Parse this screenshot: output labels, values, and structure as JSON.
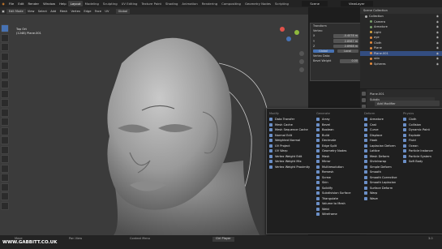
{
  "app": {
    "menu": [
      "File",
      "Edit",
      "Render",
      "Window",
      "Help"
    ],
    "workspaces": [
      "Layout",
      "Modeling",
      "Sculpting",
      "UV Editing",
      "Texture Paint",
      "Shading",
      "Animation",
      "Rendering",
      "Compositing",
      "Geometry Nodes",
      "Scripting"
    ],
    "active_workspace": "Layout",
    "scene_label": "Scene",
    "view_layer_label": "ViewLayer",
    "edit_mode": "Edit Mode"
  },
  "viewport_header": {
    "items": [
      "View",
      "Select",
      "Add",
      "Mesh",
      "Vertex",
      "Edge",
      "Face",
      "UV"
    ],
    "orientation": "Global"
  },
  "overlay_stats": {
    "line1": "Top Ort",
    "line2": "(1248) Plane.001"
  },
  "transform_panel": {
    "title": "Transform",
    "section": "Vertex:",
    "x_label": "X",
    "x_value": "-0.4078 m",
    "y_label": "Y",
    "y_value": "2.8567 m",
    "z_label": "Z",
    "z_value": "2.8968 m",
    "space_global": "Global",
    "space_local": "Local",
    "vertex_data": "Vertex Data:",
    "bevel_label": "Bevel Weight",
    "bevel_value": "0.00"
  },
  "outliner": {
    "header": "Scene Collection",
    "items": [
      {
        "label": "Collection",
        "color": "#b0b0b0",
        "selected": false
      },
      {
        "label": "Camera",
        "color": "#7aa06b",
        "selected": false
      },
      {
        "label": "Armature",
        "color": "#7aa06b",
        "selected": false
      },
      {
        "label": "Light",
        "color": "#d6a543",
        "selected": false
      },
      {
        "label": "eye",
        "color": "#e38a3d",
        "selected": false
      },
      {
        "label": "Cloth",
        "color": "#e38a3d",
        "selected": false
      },
      {
        "label": "Plane",
        "color": "#e38a3d",
        "selected": false
      },
      {
        "label": "Plane.001",
        "color": "#e38a3d",
        "selected": true
      },
      {
        "label": "skin",
        "color": "#e38a3d",
        "selected": false
      },
      {
        "label": "Spheres",
        "color": "#e38a3d",
        "selected": false
      }
    ]
  },
  "properties": {
    "object": "Plane.001",
    "modifier": "Subdiv",
    "add_modifier": "Add Modifier"
  },
  "modifier_menu": {
    "columns": [
      {
        "head": "Modify",
        "items": [
          "Data Transfer",
          "Mesh Cache",
          "Mesh Sequence Cache",
          "Normal Edit",
          "Weighted Normal",
          "UV Project",
          "UV Warp",
          "Vertex Weight Edit",
          "Vertex Weight Mix",
          "Vertex Weight Proximity"
        ]
      },
      {
        "head": "Generate",
        "items": [
          "Array",
          "Bevel",
          "Boolean",
          "Build",
          "Decimate",
          "Edge Split",
          "Geometry Nodes",
          "Mask",
          "Mirror",
          "Multiresolution",
          "Remesh",
          "Screw",
          "Skin",
          "Solidify",
          "Subdivision Surface",
          "Triangulate",
          "Volume to Mesh",
          "Weld",
          "Wireframe"
        ]
      },
      {
        "head": "Deform",
        "items": [
          "Armature",
          "Cast",
          "Curve",
          "Displace",
          "Hook",
          "Laplacian Deform",
          "Lattice",
          "Mesh Deform",
          "Shrinkwrap",
          "Simple Deform",
          "Smooth",
          "Smooth Corrective",
          "Smooth Laplacian",
          "Surface Deform",
          "Warp",
          "Wave"
        ]
      },
      {
        "head": "Physics",
        "items": [
          "Cloth",
          "Collision",
          "Dynamic Paint",
          "Explode",
          "Fluid",
          "Ocean",
          "Particle Instance",
          "Particle System",
          "Soft Body"
        ]
      }
    ]
  },
  "status": {
    "credit": "WWW.GABBITT.CO.UK",
    "items": [
      "Move",
      "Pan View",
      "Context Menu"
    ],
    "player": "Ctrl Player",
    "version": "3.0"
  },
  "colors": {
    "accent": "#4772b3",
    "selection": "#334d80",
    "panel_bg": "#2b2b2b"
  }
}
